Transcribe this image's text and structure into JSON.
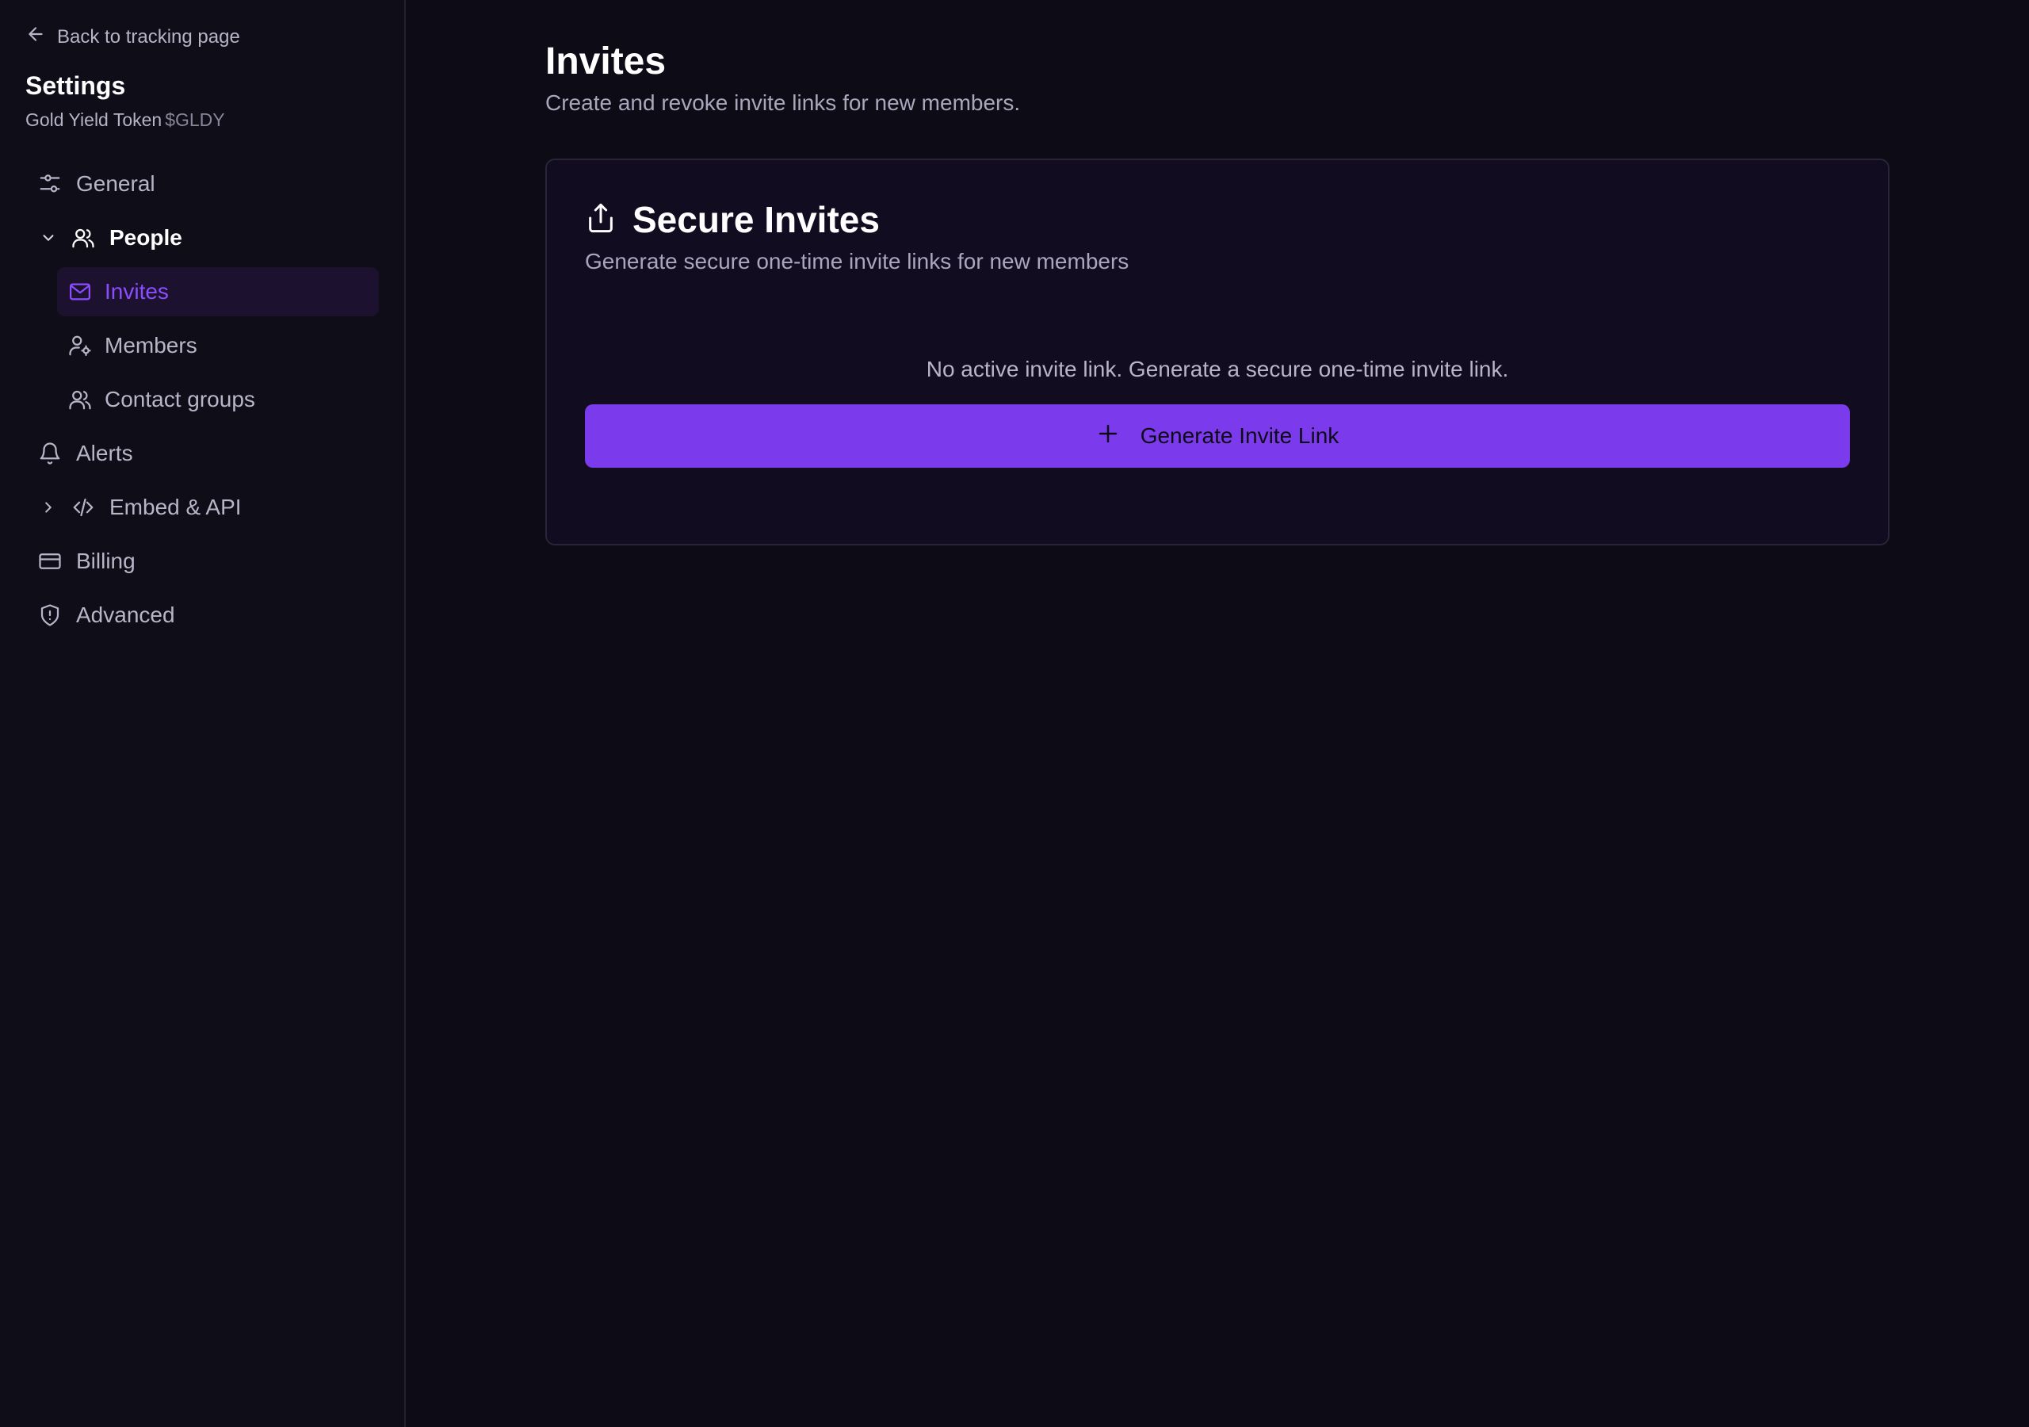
{
  "sidebar": {
    "back_label": "Back to tracking page",
    "title": "Settings",
    "project_name": "Gold Yield Token",
    "project_ticker": "$GLDY",
    "items": [
      {
        "label": "General",
        "icon": "sliders-icon"
      },
      {
        "label": "People",
        "icon": "users-icon",
        "expanded": true
      },
      {
        "label": "Invites",
        "icon": "mail-icon",
        "active": true
      },
      {
        "label": "Members",
        "icon": "user-cog-icon"
      },
      {
        "label": "Contact groups",
        "icon": "users-icon"
      },
      {
        "label": "Alerts",
        "icon": "bell-icon"
      },
      {
        "label": "Embed & API",
        "icon": "code-icon",
        "expanded": false
      },
      {
        "label": "Billing",
        "icon": "credit-card-icon"
      },
      {
        "label": "Advanced",
        "icon": "shield-alert-icon"
      }
    ]
  },
  "main": {
    "title": "Invites",
    "subtitle": "Create and revoke invite links for new members.",
    "card": {
      "title": "Secure Invites",
      "subtitle": "Generate secure one-time invite links for new members",
      "empty_text": "No active invite link. Generate a secure one-time invite link.",
      "button_label": "Generate Invite Link"
    }
  },
  "colors": {
    "accent": "#7c3aed",
    "active_text": "#8b4dff",
    "background": "#0d0b16"
  }
}
